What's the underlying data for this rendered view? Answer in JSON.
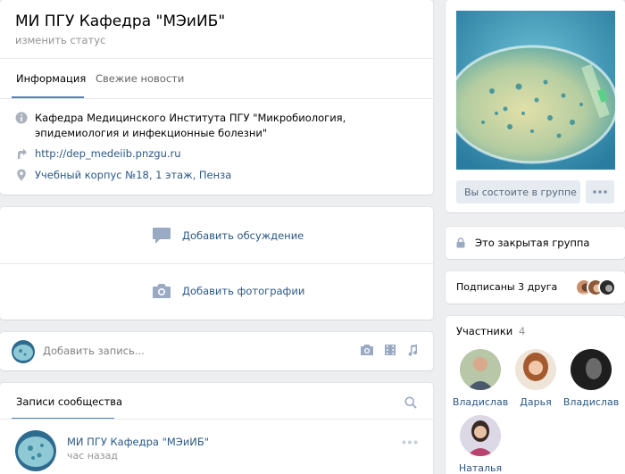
{
  "group": {
    "name": "МИ ПГУ Кафедра \"МЭиИБ\"",
    "status_placeholder": "изменить статус"
  },
  "tabs": [
    {
      "label": "Информация",
      "active": true
    },
    {
      "label": "Свежие новости",
      "active": false
    }
  ],
  "info": {
    "description": "Кафедра Медицинского Института ПГУ \"Микробиология, эпидемиология и инфекционные болезни\"",
    "link": "http://dep_medeiib.pnzgu.ru",
    "address": "Учебный корпус №18, 1 этаж, Пенза"
  },
  "actions": {
    "add_discussion": "Добавить обсуждение",
    "add_photos": "Добавить фотографии"
  },
  "composer": {
    "placeholder": "Добавить запись..."
  },
  "wall": {
    "title": "Записи сообщества",
    "post": {
      "author": "МИ ПГУ Кафедра \"МЭиИБ\"",
      "time": "час назад"
    }
  },
  "sidebar": {
    "member_button": "Вы состоите в группе",
    "closed_group": "Это закрытая группа",
    "friends_subscribed": "Подписаны 3 друга",
    "members_title": "Участники",
    "members_count": "4",
    "members": [
      {
        "name": "Владислав"
      },
      {
        "name": "Дарья"
      },
      {
        "name": "Владислав"
      },
      {
        "name": "Наталья"
      }
    ]
  },
  "colors": {
    "accent": "#5181b8",
    "link": "#2a5885",
    "background": "#edeef0"
  }
}
